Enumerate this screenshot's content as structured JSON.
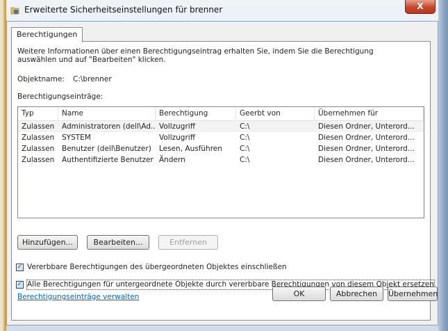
{
  "window": {
    "title": "Erweiterte Sicherheitseinstellungen für brenner",
    "close_label": "X"
  },
  "tab": {
    "label": "Berechtigungen"
  },
  "info_text": "Weitere Informationen über einen Berechtigungseintrag erhalten Sie, indem Sie die Berechtigung auswählen und auf \"Bearbeiten\" klicken.",
  "object": {
    "label": "Objektname:",
    "value": "C:\\brenner"
  },
  "entries": {
    "label": "Berechtigungseinträge:",
    "columns": [
      "Typ",
      "Name",
      "Berechtigung",
      "Geerbt von",
      "Übernehmen für"
    ],
    "rows": [
      [
        "Zulassen",
        "Administratoren (dell\\Ad...",
        "Vollzugriff",
        "C:\\",
        "Diesen Ordner, Unterord..."
      ],
      [
        "Zulassen",
        "SYSTEM",
        "Vollzugriff",
        "C:\\",
        "Diesen Ordner, Unterord..."
      ],
      [
        "Zulassen",
        "Benutzer (dell\\Benutzer)",
        "Lesen, Ausführen",
        "C:\\",
        "Diesen Ordner, Unterord..."
      ],
      [
        "Zulassen",
        "Authentifizierte Benutzer",
        "Ändern",
        "C:\\",
        "Diesen Ordner, Unterord..."
      ]
    ]
  },
  "buttons": {
    "add": "Hinzufügen...",
    "edit": "Bearbeiten...",
    "remove": "Entfernen",
    "ok": "OK",
    "cancel": "Abbrechen",
    "apply": "Übernehmen"
  },
  "checkboxes": {
    "inherit": {
      "label": "Vererbbare Berechtigungen des übergeordneten Objektes einschließen",
      "checked": true
    },
    "replace": {
      "label": "Alle Berechtigungen für untergeordnete Objekte durch vererbbare Berechtigungen von diesem Objekt ersetzen",
      "checked": true
    }
  },
  "link": {
    "label": "Berechtigungseinträge verwalten"
  },
  "icons": {
    "title": "folder-shield-icon"
  }
}
